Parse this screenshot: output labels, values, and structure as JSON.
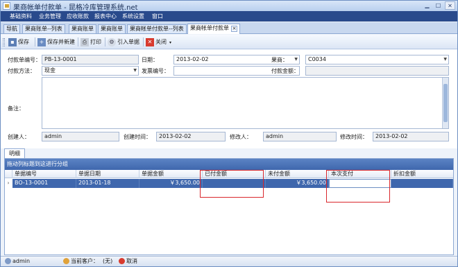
{
  "window": {
    "title": "果商帐单付款单 - 昆格冷库管理系统.net"
  },
  "menu": [
    "基础资料",
    "业务管理",
    "应收账款",
    "报表中心",
    "系统设置",
    "窗口"
  ],
  "tabs": [
    "导航",
    "果商账单--列表",
    "果商账单",
    "果商账单",
    "果商帐单付款单--列表",
    "果商帐单付款单"
  ],
  "toolbar": {
    "save": "保存",
    "save_new": "保存并新建",
    "print": "打印",
    "import": "引入单据",
    "close": "关闭"
  },
  "form": {
    "doc_no_label": "付款单编号：",
    "doc_no": "PB-13-0001",
    "date_label": "日期：",
    "date": "2013-02-02",
    "vendor_label": "果商：",
    "vendor": "C0034",
    "pay_method_label": "付款方法：",
    "pay_method": "现金",
    "invoice_label": "发票编号：",
    "invoice": "",
    "amount_label": "付款金额：",
    "amount": "",
    "remark_label": "备注：",
    "creator_label": "创建人：",
    "creator": "admin",
    "created_label": "创建时间：",
    "created": "2013-02-02",
    "modifier_label": "修改人：",
    "modifier": "admin",
    "modified_label": "修改时间：",
    "modified": "2013-02-02"
  },
  "detail_tab": "明细",
  "grid": {
    "group_hint": "拖动列标题到这进行分组",
    "columns": [
      "单据编号",
      "单据日期",
      "单据金额",
      "已付金额",
      "未付金额",
      "本次支付",
      "折扣金额"
    ],
    "row": {
      "doc_no": "BO-13-0001",
      "date": "2013-01-18",
      "amount": "￥3,650.00",
      "paid": "",
      "unpaid": "￥3,650.00",
      "this_pay": "",
      "discount": ""
    }
  },
  "status": {
    "user": "admin",
    "customer_label": "当前客户：",
    "customer": "(无)",
    "cancel": "取消"
  },
  "colors": {
    "menubar": "#294a8c",
    "selected_row": "#3f67ad",
    "highlight_box": "#d9262b"
  }
}
